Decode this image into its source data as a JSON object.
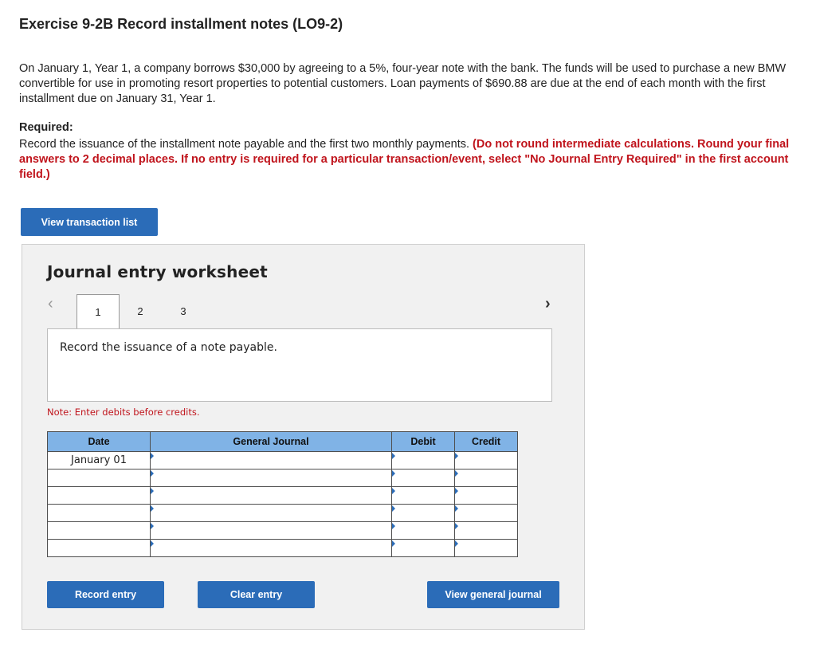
{
  "exercise": {
    "title": "Exercise 9-2B Record installment notes (LO9-2)",
    "intro": "On January 1, Year 1, a company borrows $30,000 by agreeing to a 5%, four-year note with the bank. The funds will be used to purchase a new BMW convertible for use in promoting resort properties to potential customers. Loan payments of $690.88 are due at the end of each month with the first installment due on January 31, Year 1.",
    "required_label": "Required:",
    "required_text": "Record the issuance of the installment note payable and the first two monthly payments.",
    "required_instructions": "(Do not round intermediate calculations. Round your final answers to 2 decimal places. If no entry is required for a particular transaction/event, select \"No Journal Entry Required\" in the first account field.)"
  },
  "buttons": {
    "view_transaction_list": "View transaction list",
    "record_entry": "Record entry",
    "clear_entry": "Clear entry",
    "view_general_journal": "View general journal"
  },
  "worksheet": {
    "title": "Journal entry worksheet",
    "pages": [
      "1",
      "2",
      "3"
    ],
    "active_page": "1",
    "prev_icon": "‹",
    "next_icon": "›",
    "prompt": "Record the issuance of a note payable.",
    "note": "Note: Enter debits before credits."
  },
  "journal_table": {
    "headers": {
      "date": "Date",
      "general_journal": "General Journal",
      "debit": "Debit",
      "credit": "Credit"
    },
    "rows": [
      {
        "date": "January 01"
      },
      {
        "date": ""
      },
      {
        "date": ""
      },
      {
        "date": ""
      },
      {
        "date": ""
      },
      {
        "date": ""
      }
    ]
  },
  "colors": {
    "button_blue": "#2b6cb8",
    "header_blue": "#80b3e6",
    "instruction_red": "#c0141c"
  }
}
